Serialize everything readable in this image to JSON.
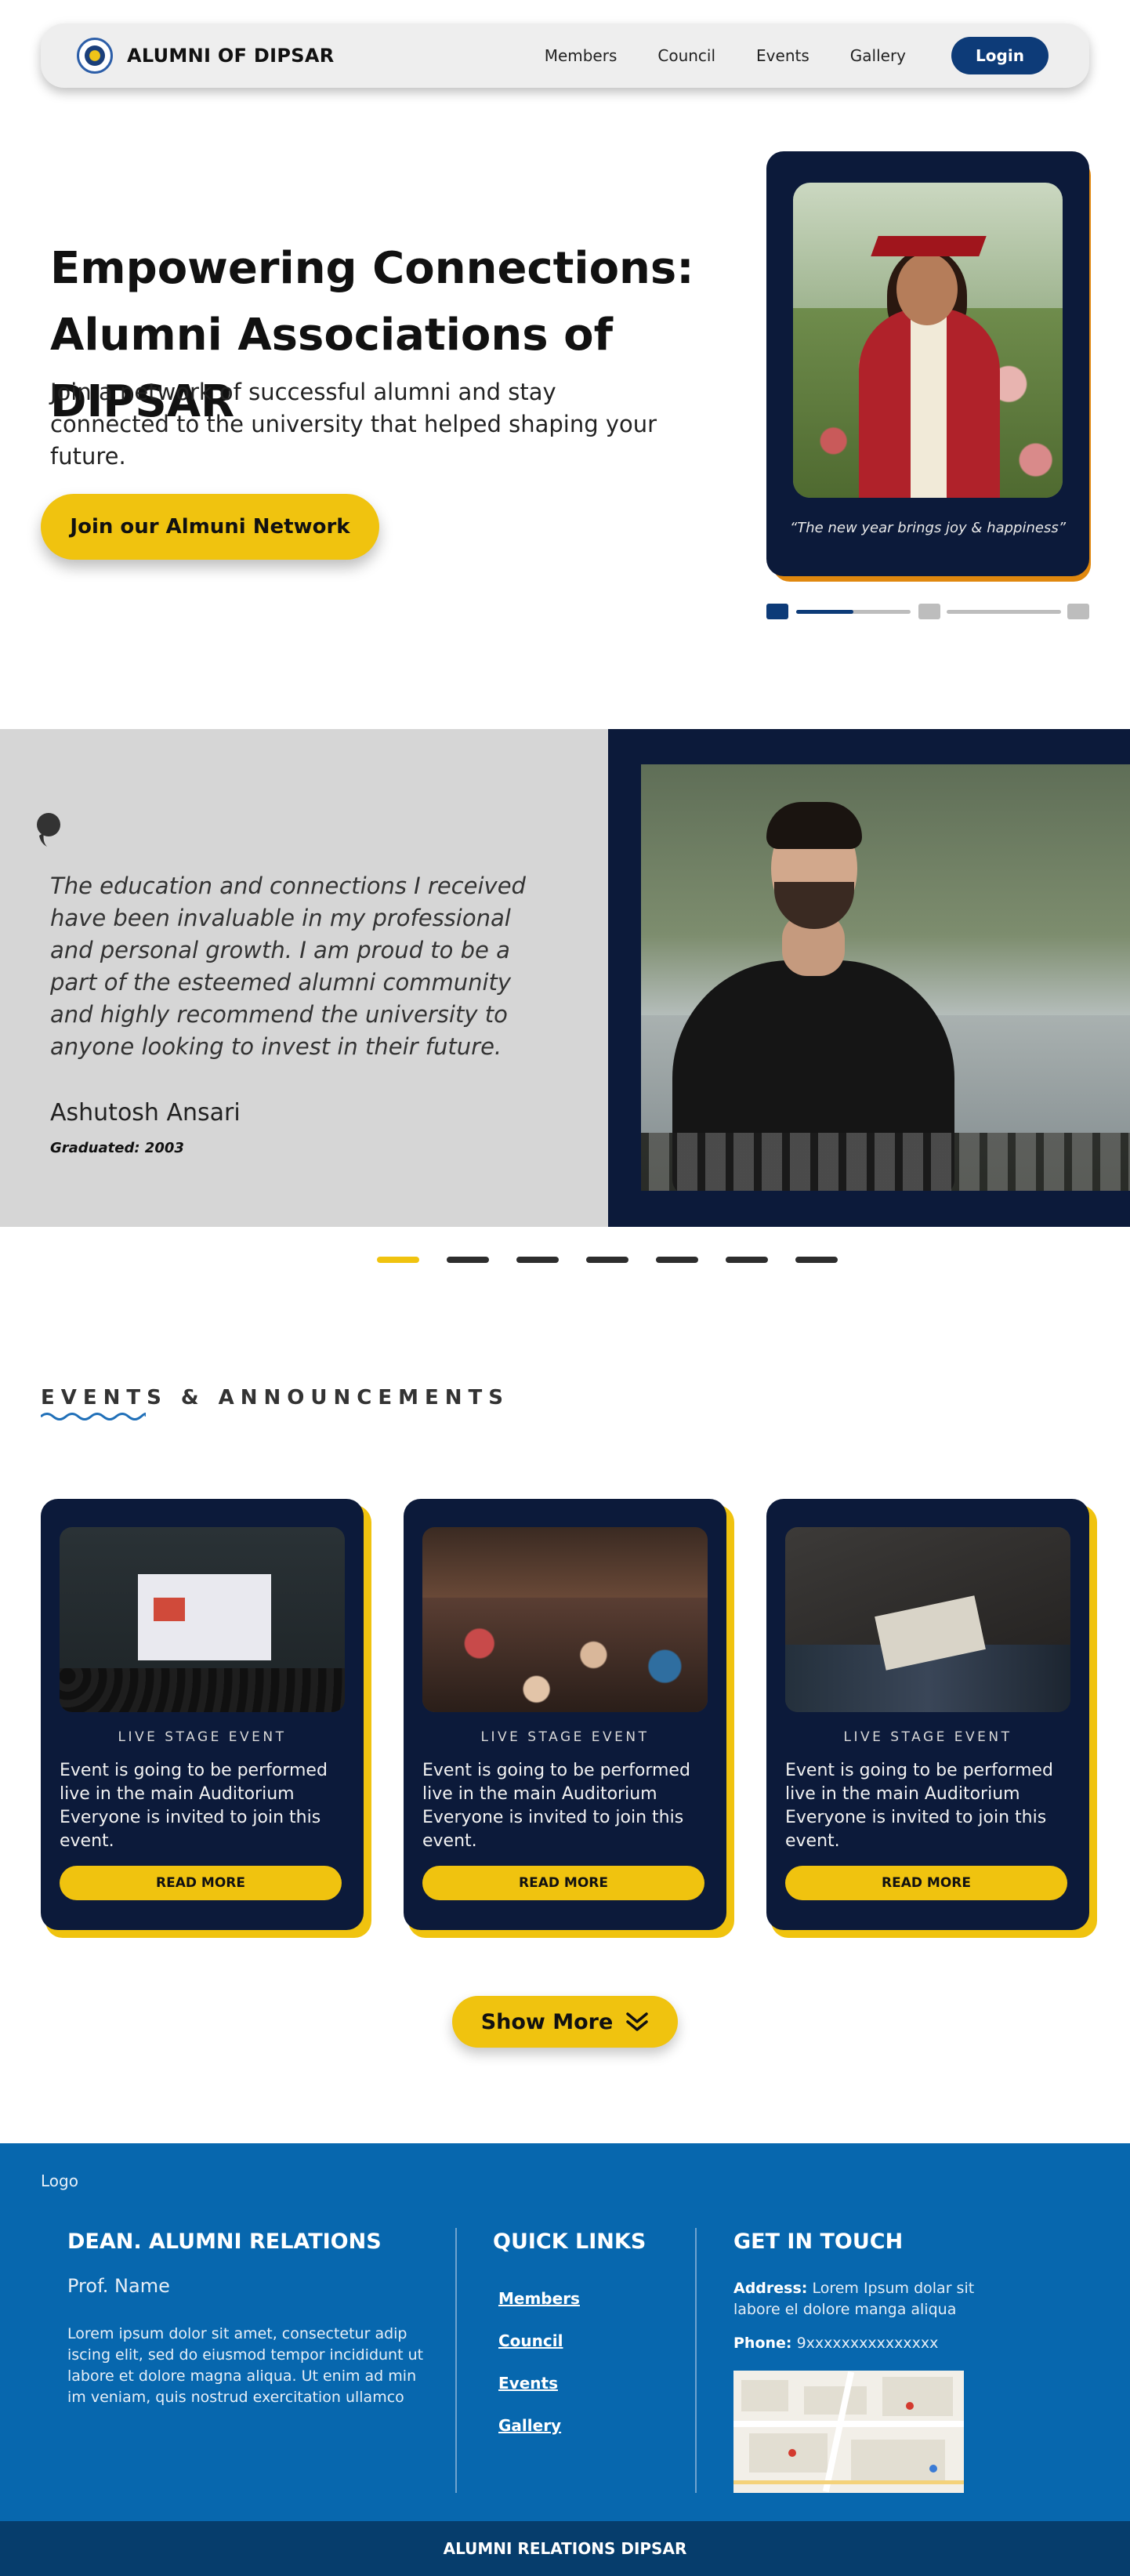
{
  "navbar": {
    "brand": "ALUMNI OF DIPSAR",
    "links": [
      "Members",
      "Council",
      "Events",
      "Gallery"
    ],
    "login_label": "Login"
  },
  "hero": {
    "title_line1": "Empowering Connections:",
    "title_line2": "Alumni Associations of DIPSAR",
    "subtitle": "Join a network of successful alumni and stay connected to the university that helped shaping your future.",
    "cta_label": "Join our Almuni Network",
    "card_quote": "“The new year brings joy & happiness”",
    "slider": {
      "current_slide": 1,
      "total_slides": 3,
      "progress": 0.5
    }
  },
  "testimonial": {
    "quote": "The education and connections I received have been invaluable in my professional and personal growth. I am proud to be a part of the esteemed alumni community and highly recommend the university to anyone looking to invest in their future.",
    "name": "Ashutosh Ansari",
    "graduated": "Graduated: 2003",
    "total_dots": 7,
    "active_dot": 1
  },
  "events": {
    "heading": "EVENTS & ANNOUNCEMENTS",
    "cards": [
      {
        "tag": "LIVE STAGE EVENT",
        "description": "Event is going to be performed live in the main Auditorium Everyone is invited to join this event.",
        "button": "READ MORE"
      },
      {
        "tag": "LIVE STAGE EVENT",
        "description": "Event is going to be performed live in the main Auditorium Everyone is invited to join this event.",
        "button": "READ MORE"
      },
      {
        "tag": "LIVE STAGE EVENT",
        "description": "Event is going to be performed live in the main Auditorium Everyone is invited to join this event.",
        "button": "READ MORE"
      }
    ],
    "show_more": "Show More"
  },
  "footer": {
    "logo": "Logo",
    "dean": {
      "heading": "DEAN. ALUMNI RELATIONS",
      "name": "Prof. Name",
      "text": "Lorem ipsum dolor sit amet, consectetur adip iscing elit, sed do eiusmod tempor incididunt ut labore et dolore magna aliqua. Ut enim ad min im veniam, quis nostrud exercitation ullamco"
    },
    "quick_links": {
      "heading": "QUICK LINKS",
      "links": [
        "Members",
        "Council",
        "Events",
        "Gallery"
      ]
    },
    "contact": {
      "heading": "GET IN TOUCH",
      "address_label": "Address:",
      "address": "Lorem Ipsum dolar sit labore el dolore manga aliqua",
      "phone_label": "Phone:",
      "phone": "9xxxxxxxxxxxxxxx"
    },
    "bottom": "ALUMNI RELATIONS DIPSAR"
  },
  "colors": {
    "navy": "#0c1a3a",
    "accent_yellow": "#f0c30f",
    "brand_blue": "#0d3b78",
    "footer_blue": "#0767ae",
    "footer_bottom": "#063d6c",
    "orange_shadow": "#e0880f"
  }
}
